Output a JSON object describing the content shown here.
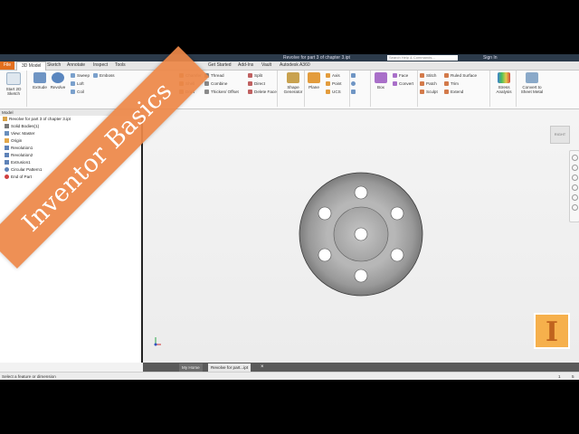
{
  "window": {
    "title": "Revolve for part 3 of chapter 3.ipt",
    "search_placeholder": "Search Help & Commands...",
    "sign_in": "Sign In"
  },
  "ribbon_tabs": [
    "File",
    "3D Model",
    "Sketch",
    "Annotate",
    "Inspect",
    "Tools",
    "Get Started",
    "Vault",
    "Add-Ins",
    "Autodesk A360"
  ],
  "ribbon": {
    "start_sketch": "Start 2D Sketch",
    "extrude": "Extrude",
    "revolve": "Revolve",
    "sweep": "Sweep",
    "emboss": "Emboss",
    "loft": "Loft",
    "coil": "Coil",
    "chamfer": "Chamfer",
    "shell": "Shell",
    "draft": "Draft",
    "thread": "Thread",
    "combine": "Combine",
    "thicken": "Thicken/ Offset",
    "split": "Split",
    "direct": "Direct",
    "delete_face": "Delete Face",
    "shape_generator": "Shape Generator",
    "plane": "Plane",
    "axis": "Axis",
    "point": "Point",
    "ucs": "UCS",
    "box": "Box",
    "face": "Face",
    "convert": "Convert",
    "stitch": "Stitch",
    "patch": "Patch",
    "sculpt": "Sculpt",
    "ruled_surface": "Ruled Surface",
    "trim": "Trim",
    "extend": "Extend",
    "stress_analysis": "Stress Analysis",
    "convert_sheet_metal": "Convert to Sheet Metal"
  },
  "ribbon_groups": {
    "sketch": "Sketch",
    "create": "Create",
    "modify": "Modify",
    "explore": "Explore",
    "work_features": "Work Features",
    "pattern": "Pattern",
    "create_freeform": "Create Freeform",
    "surface": "Surface",
    "simulation": "Simulation",
    "convert": "Convert"
  },
  "browser": {
    "header": "Model",
    "root": "Revolve for part 3 of chapter 3.ipt",
    "items": [
      "Solid Bodies(1)",
      "View: Master",
      "Origin",
      "Revolution1",
      "Revolution2",
      "Extrusion1",
      "Circular Pattern1",
      "End of Part"
    ]
  },
  "viewcube_label": "RIGHT",
  "doc_tabs": {
    "home": "My Home",
    "active": "Revolve for part...ipt"
  },
  "status": {
    "message": "Select a feature or dimension",
    "count1": "1",
    "count2": "5"
  },
  "banner": "Inventor Basics",
  "logo_letter": "I",
  "colors": {
    "file_tab": "#e36f1e",
    "banner": "#ed8848",
    "logo": "#f6b04c",
    "part_gray": "#a8a8a8"
  }
}
